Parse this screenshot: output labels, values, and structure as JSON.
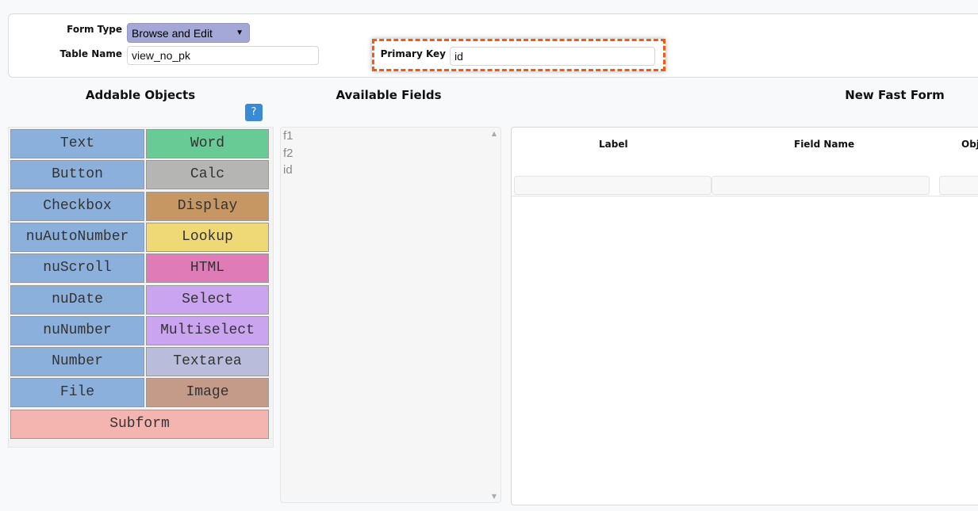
{
  "header": {
    "form_type_label": "Form Type",
    "form_type_value": "Browse and Edit",
    "table_name_label": "Table Name",
    "table_name_value": "view_no_pk",
    "primary_key_label": "Primary Key",
    "primary_key_value": "id",
    "highlight_color": "#f05a14"
  },
  "addable": {
    "title": "Addable Objects",
    "help": "?",
    "objects": [
      {
        "label": "Text",
        "color": "#8cb0dc"
      },
      {
        "label": "Word",
        "color": "#68ca94"
      },
      {
        "label": "Button",
        "color": "#8cb0dc"
      },
      {
        "label": "Calc",
        "color": "#b5b5b3"
      },
      {
        "label": "Checkbox",
        "color": "#8cb0dc"
      },
      {
        "label": "Display",
        "color": "#c69762"
      },
      {
        "label": "nuAutoNumber",
        "color": "#8cb0dc"
      },
      {
        "label": "Lookup",
        "color": "#eed976"
      },
      {
        "label": "nuScroll",
        "color": "#8cb0dc"
      },
      {
        "label": "HTML",
        "color": "#df7bb7"
      },
      {
        "label": "nuDate",
        "color": "#8cb0dc"
      },
      {
        "label": "Select",
        "color": "#caa4ef"
      },
      {
        "label": "nuNumber",
        "color": "#8cb0dc"
      },
      {
        "label": "Multiselect",
        "color": "#caa4ef"
      },
      {
        "label": "Number",
        "color": "#8cb0dc"
      },
      {
        "label": "Textarea",
        "color": "#b9bcdb"
      },
      {
        "label": "File",
        "color": "#8cb0dc"
      },
      {
        "label": "Image",
        "color": "#c49a88"
      },
      {
        "label": "Subform",
        "color": "#f4b4af"
      }
    ]
  },
  "fields": {
    "title": "Available Fields",
    "items": [
      "f1",
      "f2",
      "id"
    ]
  },
  "fastform": {
    "title": "New Fast Form",
    "columns": [
      "Label",
      "Field Name",
      "Obj"
    ]
  }
}
